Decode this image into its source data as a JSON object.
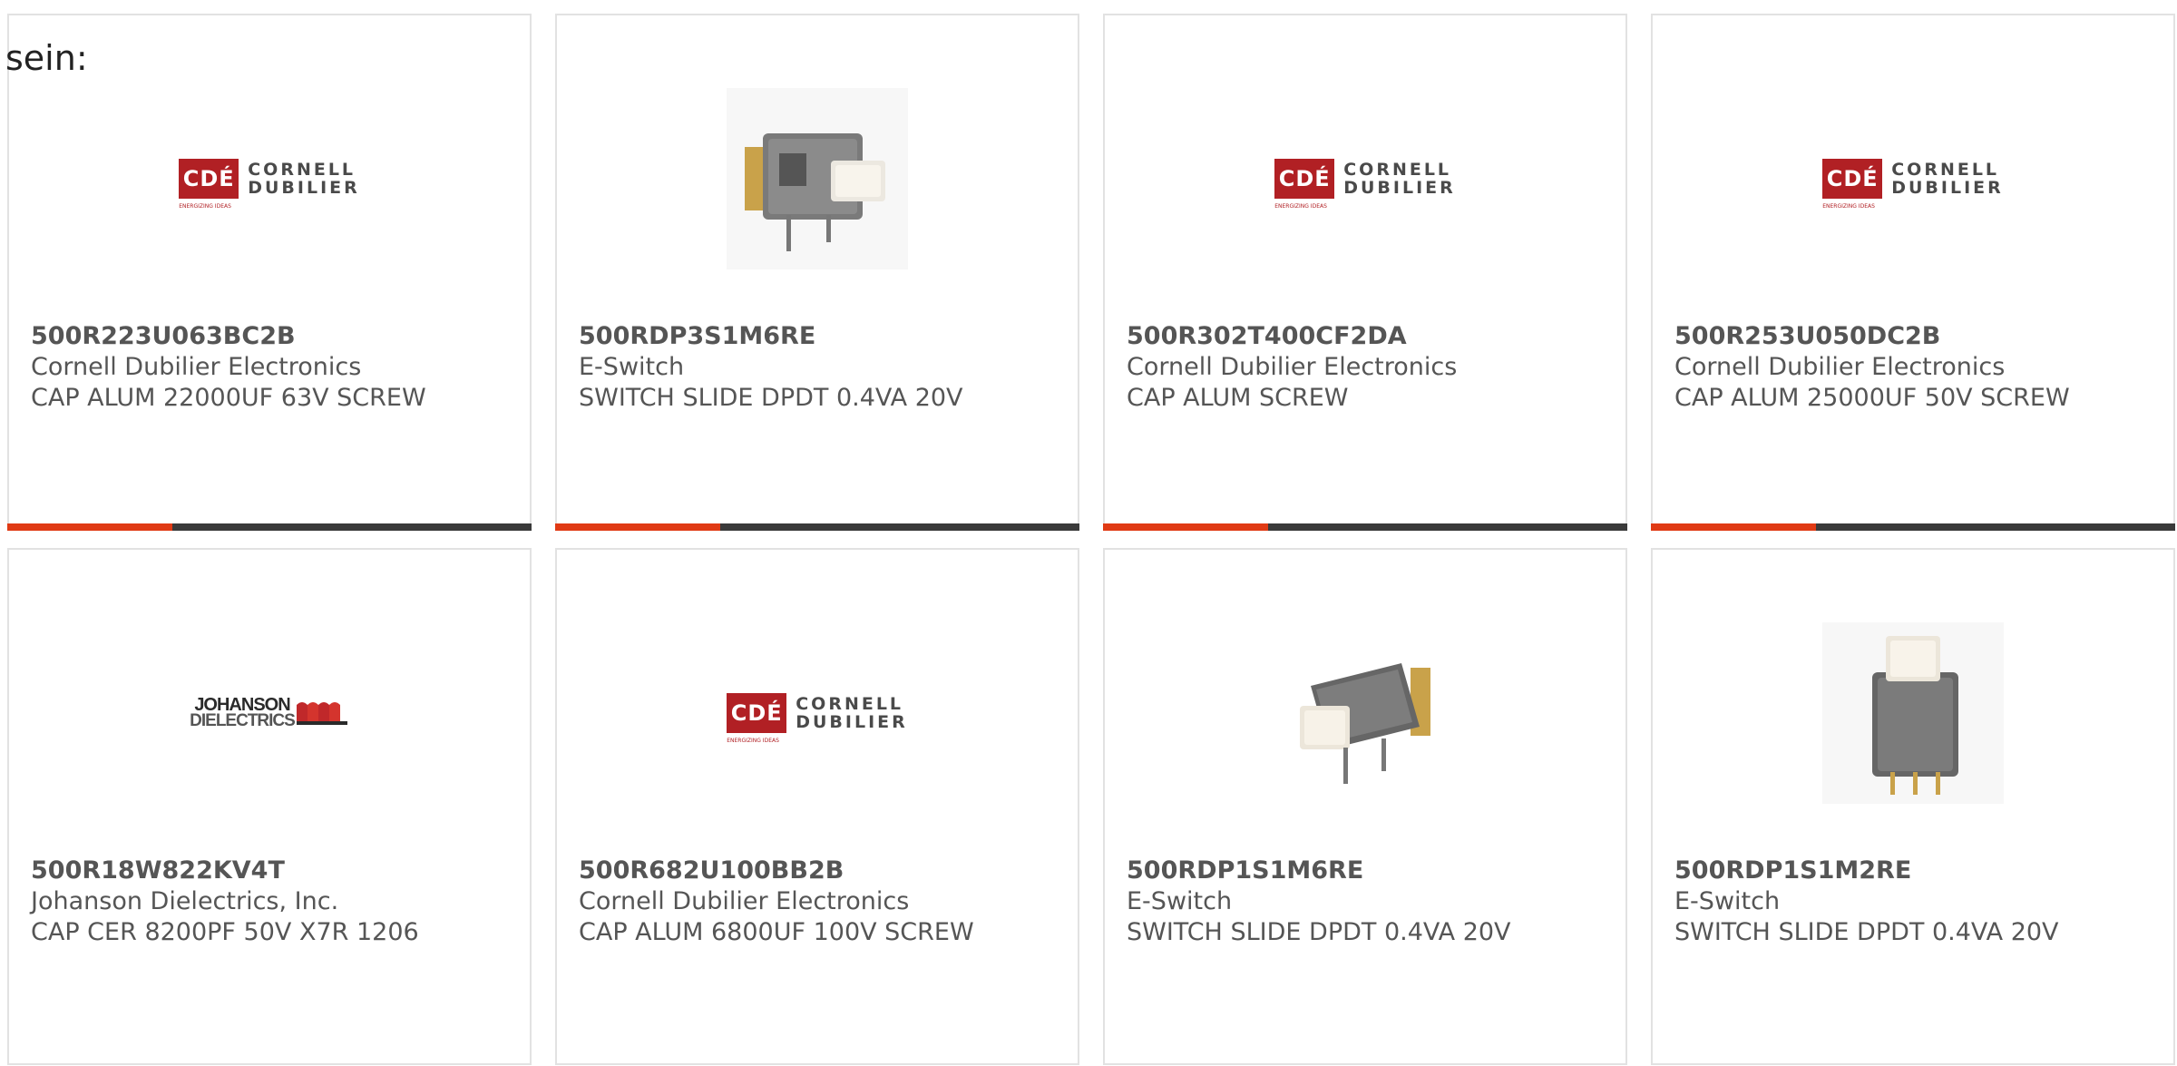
{
  "intro_text": "sein:",
  "accent_color": "#e03a14",
  "bar_color": "#3a3a3a",
  "logos": {
    "cde": {
      "badge": "CDÉ",
      "line1": "CORNELL",
      "line2": "DUBILIER",
      "tagline": "ENERGIZING IDEAS"
    },
    "johanson": {
      "line1": "JOHANSON",
      "line2": "DIELECTRICS"
    }
  },
  "products": [
    {
      "part": "500R223U063BC2B",
      "maker": "Cornell Dubilier Electronics",
      "desc": "CAP ALUM 22000UF 63V SCREW",
      "image": "cde-logo"
    },
    {
      "part": "500RDP3S1M6RE",
      "maker": "E-Switch",
      "desc": "SWITCH SLIDE DPDT 0.4VA 20V",
      "image": "slide-switch-photo"
    },
    {
      "part": "500R302T400CF2DA",
      "maker": "Cornell Dubilier Electronics",
      "desc": "CAP ALUM SCREW",
      "image": "cde-logo"
    },
    {
      "part": "500R253U050DC2B",
      "maker": "Cornell Dubilier Electronics",
      "desc": "CAP ALUM 25000UF 50V SCREW",
      "image": "cde-logo"
    },
    {
      "part": "500R18W822KV4T",
      "maker": "Johanson Dielectrics, Inc.",
      "desc": "CAP CER 8200PF 50V X7R 1206",
      "image": "johanson-logo"
    },
    {
      "part": "500R682U100BB2B",
      "maker": "Cornell Dubilier Electronics",
      "desc": "CAP ALUM 6800UF 100V SCREW",
      "image": "cde-logo"
    },
    {
      "part": "500RDP1S1M6RE",
      "maker": "E-Switch",
      "desc": "SWITCH SLIDE DPDT 0.4VA 20V",
      "image": "slide-switch-photo"
    },
    {
      "part": "500RDP1S1M2RE",
      "maker": "E-Switch",
      "desc": "SWITCH SLIDE DPDT 0.4VA 20V",
      "image": "slide-switch-photo"
    }
  ]
}
